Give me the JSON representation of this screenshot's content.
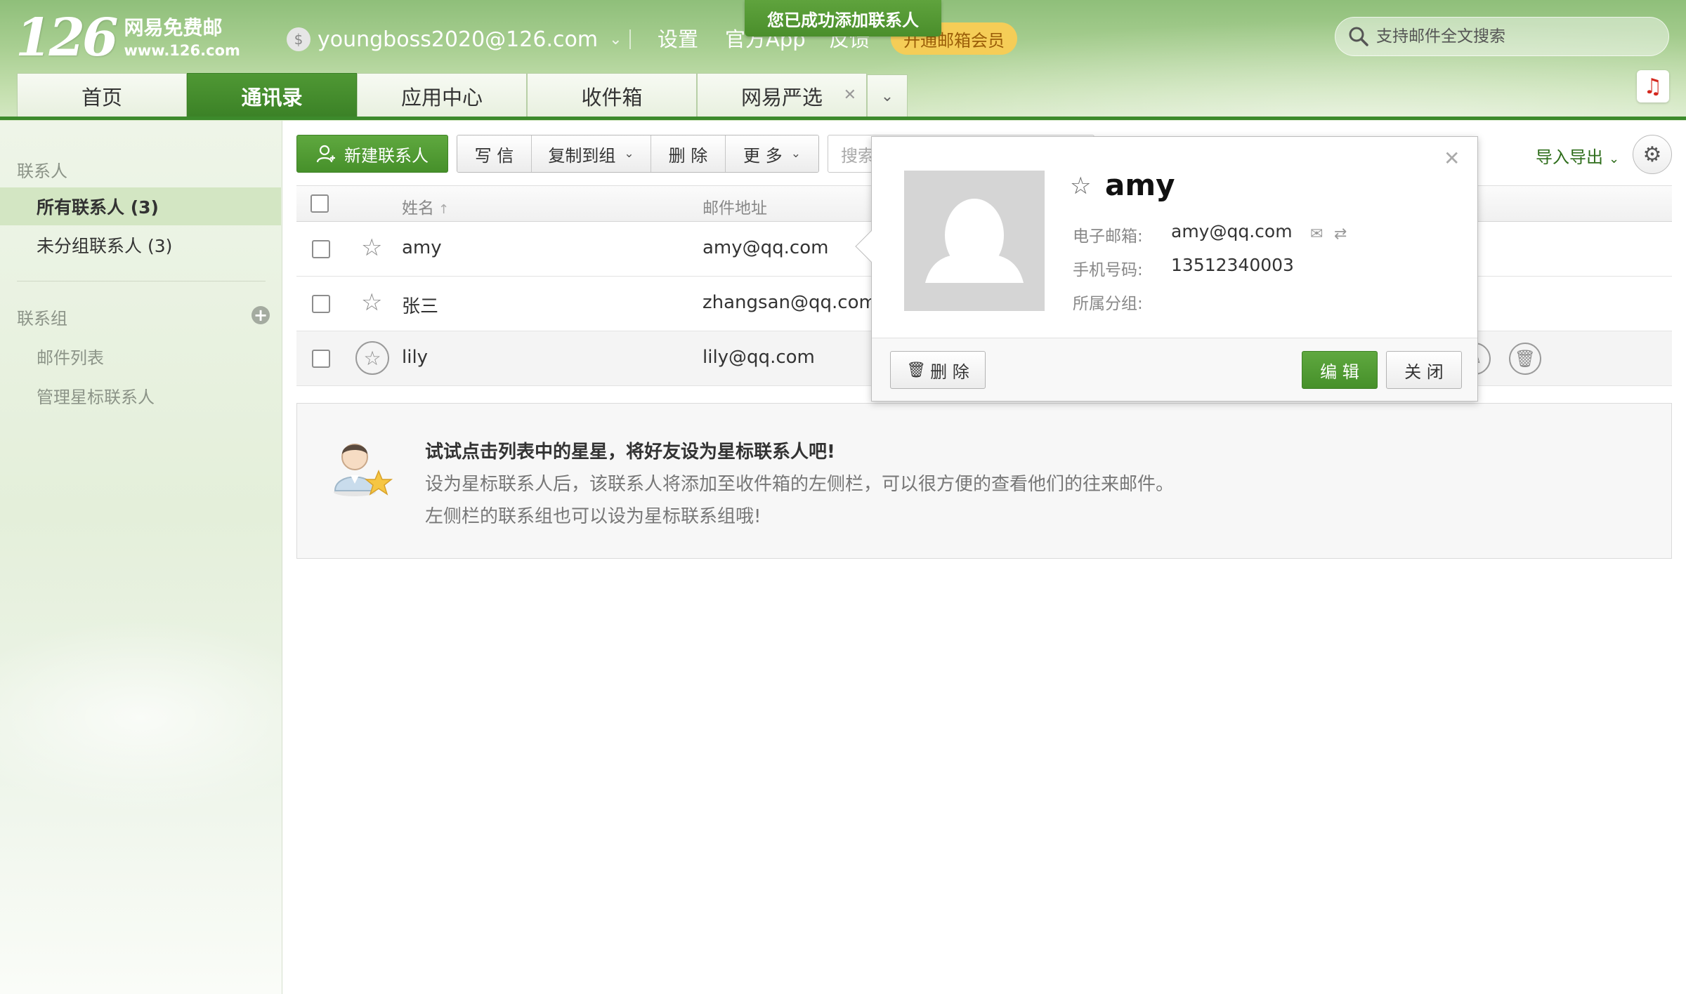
{
  "header": {
    "logo_number": "126",
    "logo_name": "网易免费邮",
    "logo_url": "www.126.com",
    "account": "youngboss2020@126.com",
    "links": [
      "设置",
      "官方App",
      "反馈"
    ],
    "vip_button": "开通邮箱会员",
    "toast": "您已成功添加联系人",
    "search_placeholder": "支持邮件全文搜索"
  },
  "tabs": [
    {
      "label": "首页",
      "active": false
    },
    {
      "label": "通讯录",
      "active": true
    },
    {
      "label": "应用中心",
      "active": false
    },
    {
      "label": "收件箱",
      "active": false
    },
    {
      "label": "网易严选",
      "active": false,
      "closable": true
    }
  ],
  "sidebar": {
    "contacts_title": "联系人",
    "contact_items": [
      {
        "label": "所有联系人 (3)",
        "active": true
      },
      {
        "label": "未分组联系人 (3)",
        "active": false
      }
    ],
    "groups_title": "联系组",
    "group_items": [
      "邮件列表",
      "管理星标联系人"
    ]
  },
  "toolbar": {
    "new_contact": "新建联系人",
    "write": "写 信",
    "copy_to_group": "复制到组",
    "delete": "删 除",
    "more": "更 多",
    "search_placeholder": "搜索",
    "import_export": "导入导出"
  },
  "table": {
    "col_name": "姓名",
    "col_email": "邮件地址",
    "rows": [
      {
        "name": "amy",
        "email": "amy@qq.com"
      },
      {
        "name": "张三",
        "email": "zhangsan@qq.com"
      },
      {
        "name": "lily",
        "email": "lily@qq.com"
      }
    ]
  },
  "tip": {
    "title": "试试点击列表中的星星，将好友设为星标联系人吧!",
    "line1": "设为星标联系人后，该联系人将添加至收件箱的左侧栏，可以很方便的查看他们的往来邮件。",
    "line2": "左侧栏的联系组也可以设为星标联系组哦!"
  },
  "popup": {
    "name": "amy",
    "email_label": "电子邮箱:",
    "email": "amy@qq.com",
    "phone_label": "手机号码:",
    "phone": "13512340003",
    "group_label": "所属分组:",
    "group": "",
    "delete": "删 除",
    "edit": "编 辑",
    "close": "关 闭"
  },
  "colors": {
    "brand_green": "#3d8a2c",
    "vip_yellow": "#f5cd57"
  }
}
